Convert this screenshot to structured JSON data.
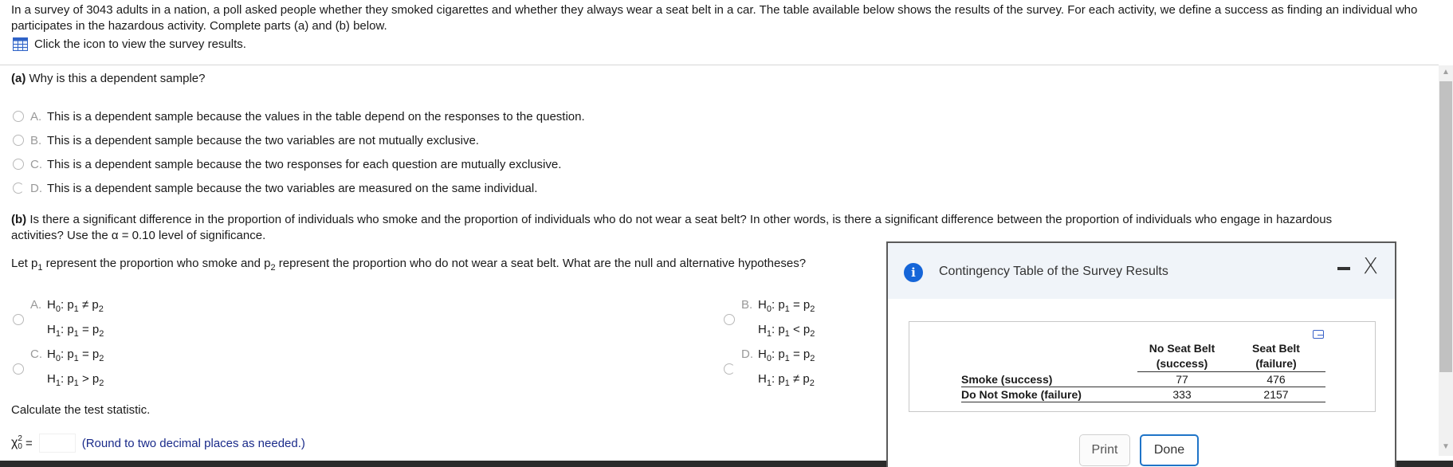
{
  "intro": {
    "text": "In a survey of 3043 adults in a nation, a poll asked people whether they smoked cigarettes and whether they always wear a seat belt in a car. The table available below shows the results of the survey. For each activity, we define a success as finding an individual who participates in the hazardous activity. Complete parts (a) and (b) below.",
    "link_label": "Click the icon to view the survey results."
  },
  "part_a": {
    "label": "(a)",
    "question": "Why is this a dependent sample?",
    "options": [
      {
        "letter": "A.",
        "text": "This is a dependent sample because the values in the table depend on the responses to the question."
      },
      {
        "letter": "B.",
        "text": "This is a dependent sample because the two variables are not mutually exclusive."
      },
      {
        "letter": "C.",
        "text": "This is a dependent sample because the two responses for each question are mutually exclusive."
      },
      {
        "letter": "D.",
        "text": "This is a dependent sample because the two variables are measured on the same individual."
      }
    ]
  },
  "part_b": {
    "label": "(b)",
    "question_1": "Is there a significant difference in the proportion of individuals who smoke and the proportion of individuals who do not wear a seat belt? In other words, is there a significant difference between the proportion of individuals who engage in hazardous",
    "question_2": "activities? Use the α = 0.10 level of significance.",
    "let_pre": "Let p",
    "let_mid": " represent the proportion who smoke and p",
    "let_post": " represent the proportion who do not wear a seat belt. What are the null and alternative hypotheses?",
    "sub1": "1",
    "sub2": "2",
    "sub0": "0",
    "h": "H",
    "p": "p",
    "options": [
      {
        "letter": "A.",
        "h0_rel": "≠",
        "h1_rel": "="
      },
      {
        "letter": "B.",
        "h0_rel": "=",
        "h1_rel": "<"
      },
      {
        "letter": "C.",
        "h0_rel": "=",
        "h1_rel": ">"
      },
      {
        "letter": "D.",
        "h0_rel": "=",
        "h1_rel": "≠"
      }
    ],
    "calc_label": "Calculate the test statistic.",
    "chi_label": "χ",
    "chi_sup": "2",
    "chi_sub": "0",
    "equals": "=",
    "round_note": "(Round to two decimal places as needed.)"
  },
  "dialog": {
    "title": "Contingency Table of the Survey Results",
    "info_icon": "i",
    "close_label": "X",
    "table": {
      "col_headers": [
        {
          "line1": "No Seat Belt",
          "line2": "(success)"
        },
        {
          "line1": "Seat Belt",
          "line2": "(failure)"
        }
      ],
      "rows": [
        {
          "label": "Smoke (success)",
          "values": [
            "77",
            "476"
          ]
        },
        {
          "label": "Do Not Smoke (failure)",
          "values": [
            "333",
            "2157"
          ]
        }
      ]
    },
    "print_label": "Print",
    "done_label": "Done"
  },
  "colors": {
    "accent": "#1565d8",
    "note": "#1a2b8a",
    "done_border": "#1f74c8"
  }
}
